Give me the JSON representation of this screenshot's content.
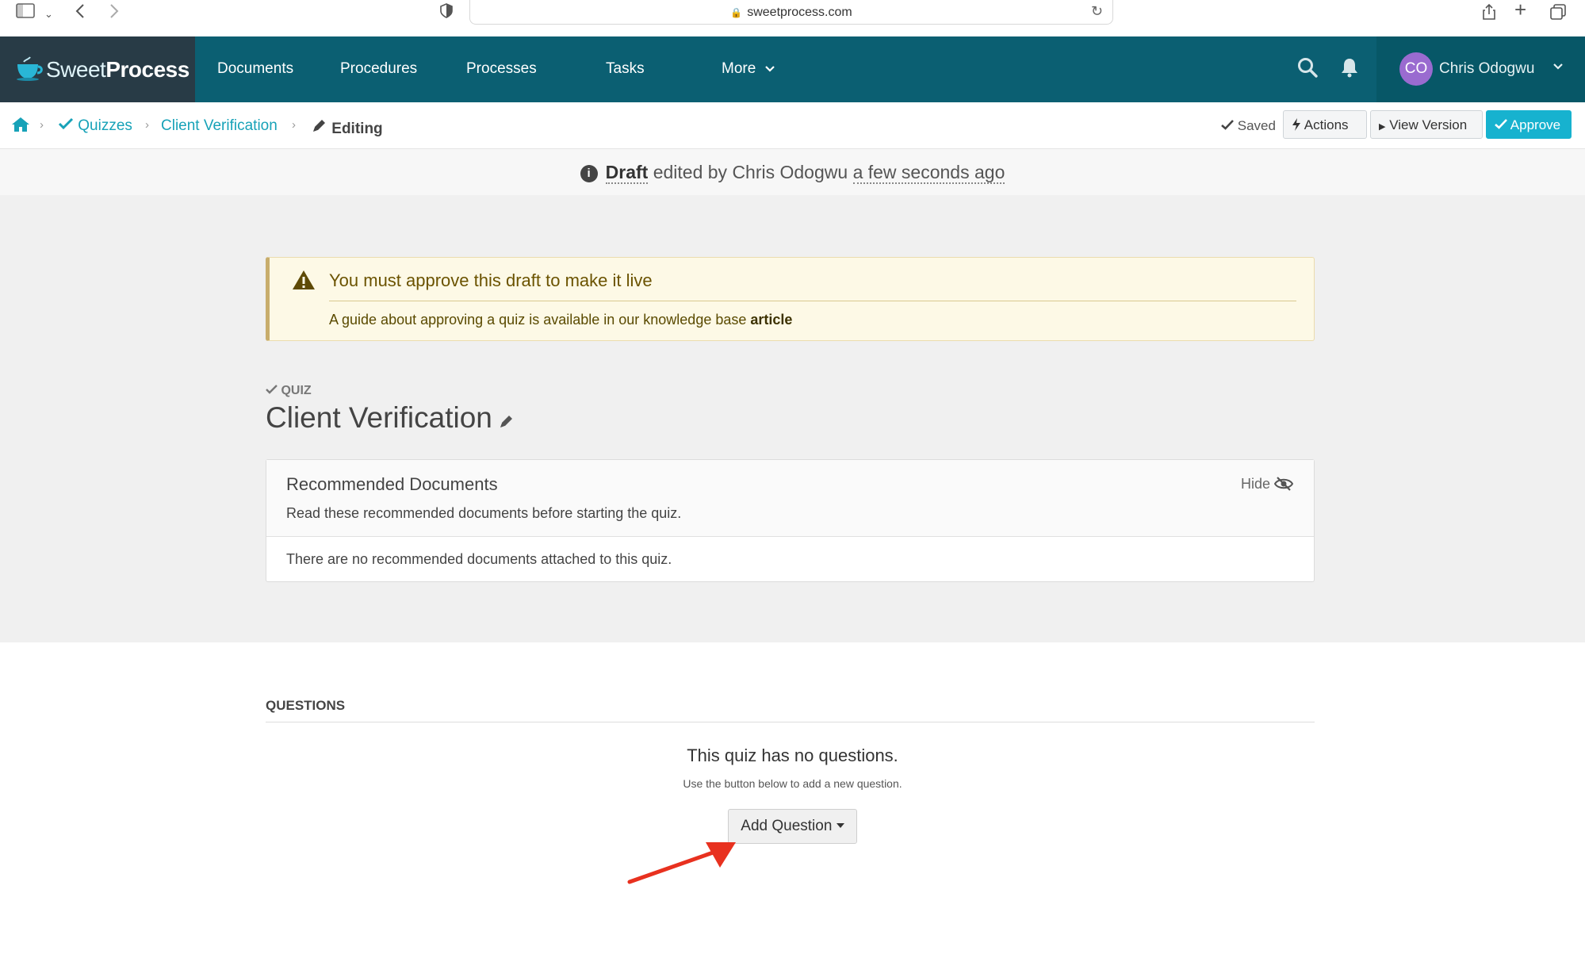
{
  "browser": {
    "url": "sweetprocess.com"
  },
  "brand": {
    "name_light": "Sweet",
    "name_bold": "Process"
  },
  "nav": {
    "items": [
      "Documents",
      "Procedures",
      "Processes",
      "Tasks",
      "More"
    ]
  },
  "user": {
    "initials": "CO",
    "name": "Chris Odogwu"
  },
  "breadcrumb": {
    "quizzes": "Quizzes",
    "item": "Client Verification",
    "current": "Editing"
  },
  "toolbar": {
    "saved": "Saved",
    "actions": "Actions",
    "view_version": "View Version",
    "approve": "Approve"
  },
  "draft": {
    "status": "Draft",
    "edited_by": "edited by Chris Odogwu",
    "time": "a few seconds ago"
  },
  "alert": {
    "title": "You must approve this draft to make it live",
    "body": "A guide about approving a quiz is available in our knowledge base",
    "link": "article"
  },
  "quiz": {
    "type_label": "QUIZ",
    "title": "Client Verification"
  },
  "recommended": {
    "title": "Recommended Documents",
    "subtitle": "Read these recommended documents before starting the quiz.",
    "hide": "Hide",
    "empty": "There are no recommended documents attached to this quiz."
  },
  "questions": {
    "label": "QUESTIONS",
    "empty_title": "This quiz has no questions.",
    "empty_sub": "Use the button below to add a new question.",
    "add_button": "Add Question"
  },
  "colors": {
    "nav_bg": "#0b5f72",
    "brand_bg": "#283b46",
    "accent": "#17a2b8",
    "approve": "#17b2cf",
    "arrow": "#e8311f"
  }
}
